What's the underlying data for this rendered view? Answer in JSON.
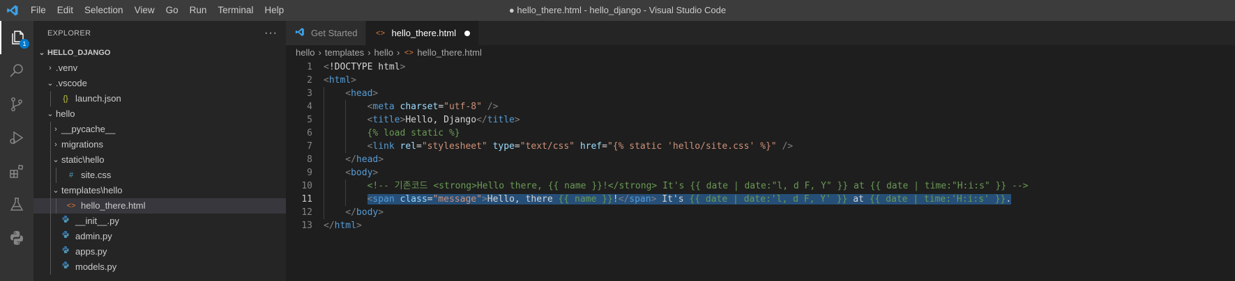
{
  "window": {
    "title": "● hello_there.html - hello_django - Visual Studio Code"
  },
  "menu": [
    "File",
    "Edit",
    "Selection",
    "View",
    "Go",
    "Run",
    "Terminal",
    "Help"
  ],
  "activity": {
    "items": [
      "explorer-icon",
      "search-icon",
      "source-control-icon",
      "run-debug-icon",
      "extensions-icon",
      "testing-icon",
      "python-icon"
    ],
    "explorer_badge": "1"
  },
  "sidebar": {
    "title": "EXPLORER",
    "more": "···",
    "root": "HELLO_DJANGO",
    "rows": [
      {
        "label": ".venv",
        "chev": "›",
        "icon": ""
      },
      {
        "label": ".vscode",
        "chev": "⌄",
        "icon": ""
      },
      {
        "label": "launch.json",
        "chev": "",
        "icon": "{}"
      },
      {
        "label": "hello",
        "chev": "⌄",
        "icon": ""
      },
      {
        "label": "__pycache__",
        "chev": "›",
        "icon": ""
      },
      {
        "label": "migrations",
        "chev": "›",
        "icon": ""
      },
      {
        "label": "static\\hello",
        "chev": "⌄",
        "icon": ""
      },
      {
        "label": "site.css",
        "chev": "",
        "icon": "#"
      },
      {
        "label": "templates\\hello",
        "chev": "⌄",
        "icon": ""
      },
      {
        "label": "hello_there.html",
        "chev": "",
        "icon": "<>"
      },
      {
        "label": "__init__.py",
        "chev": "",
        "icon": "py"
      },
      {
        "label": "admin.py",
        "chev": "",
        "icon": "py"
      },
      {
        "label": "apps.py",
        "chev": "",
        "icon": "py"
      },
      {
        "label": "models.py",
        "chev": "",
        "icon": "py"
      }
    ]
  },
  "tabs": [
    {
      "label": "Get Started",
      "icon": "vscode-logo-icon"
    },
    {
      "label": "hello_there.html",
      "icon": "html-file-icon",
      "dirty": "●"
    }
  ],
  "breadcrumbs": [
    "hello",
    "templates",
    "hello",
    "hello_there.html"
  ],
  "editor": {
    "current_line": 11,
    "lines": [
      {
        "n": "1",
        "indent": 0,
        "parts": [
          [
            "t-br",
            "<"
          ],
          [
            "t-txt",
            "!DOCTYPE html"
          ],
          [
            "t-br",
            ">"
          ]
        ]
      },
      {
        "n": "2",
        "indent": 0,
        "parts": [
          [
            "t-br",
            "<"
          ],
          [
            "t-tag",
            "html"
          ],
          [
            "t-br",
            ">"
          ]
        ]
      },
      {
        "n": "3",
        "indent": 1,
        "parts": [
          [
            "t-br",
            "<"
          ],
          [
            "t-tag",
            "head"
          ],
          [
            "t-br",
            ">"
          ]
        ]
      },
      {
        "n": "4",
        "indent": 2,
        "parts": [
          [
            "t-br",
            "<"
          ],
          [
            "t-tag",
            "meta"
          ],
          [
            "t-txt",
            " "
          ],
          [
            "t-attr",
            "charset"
          ],
          [
            "t-txt",
            "="
          ],
          [
            "t-str",
            "\"utf-8\""
          ],
          [
            "t-txt",
            " "
          ],
          [
            "t-br",
            "/>"
          ]
        ]
      },
      {
        "n": "5",
        "indent": 2,
        "parts": [
          [
            "t-br",
            "<"
          ],
          [
            "t-tag",
            "title"
          ],
          [
            "t-br",
            ">"
          ],
          [
            "t-txt",
            "Hello, Django"
          ],
          [
            "t-br",
            "</"
          ],
          [
            "t-tag",
            "title"
          ],
          [
            "t-br",
            ">"
          ]
        ]
      },
      {
        "n": "6",
        "indent": 2,
        "parts": [
          [
            "t-tpl",
            "{% load static %}"
          ]
        ]
      },
      {
        "n": "7",
        "indent": 2,
        "parts": [
          [
            "t-br",
            "<"
          ],
          [
            "t-tag",
            "link"
          ],
          [
            "t-txt",
            " "
          ],
          [
            "t-attr",
            "rel"
          ],
          [
            "t-txt",
            "="
          ],
          [
            "t-str",
            "\"stylesheet\""
          ],
          [
            "t-txt",
            " "
          ],
          [
            "t-attr",
            "type"
          ],
          [
            "t-txt",
            "="
          ],
          [
            "t-str",
            "\"text/css\""
          ],
          [
            "t-txt",
            " "
          ],
          [
            "t-attr",
            "href"
          ],
          [
            "t-txt",
            "="
          ],
          [
            "t-str",
            "\"{% static 'hello/site.css' %}\""
          ],
          [
            "t-txt",
            " "
          ],
          [
            "t-br",
            "/>"
          ]
        ]
      },
      {
        "n": "8",
        "indent": 1,
        "parts": [
          [
            "t-br",
            "</"
          ],
          [
            "t-tag",
            "head"
          ],
          [
            "t-br",
            ">"
          ]
        ]
      },
      {
        "n": "9",
        "indent": 1,
        "parts": [
          [
            "t-br",
            "<"
          ],
          [
            "t-tag",
            "body"
          ],
          [
            "t-br",
            ">"
          ]
        ]
      },
      {
        "n": "10",
        "indent": 2,
        "parts": [
          [
            "t-cmt",
            "<!-- 기존코드 <strong>Hello there, {{ name }}!</strong> It's {{ date | date:\"l, d F, Y\" }} at {{ date | time:\"H:i:s\" }} -->"
          ]
        ]
      },
      {
        "n": "11",
        "indent": 2,
        "sel": true,
        "parts": [
          [
            "t-br",
            "<"
          ],
          [
            "t-tag",
            "span"
          ],
          [
            "t-txt",
            " "
          ],
          [
            "t-attr",
            "class"
          ],
          [
            "t-txt",
            "="
          ],
          [
            "t-str",
            "\"message\""
          ],
          [
            "t-br",
            ">"
          ],
          [
            "t-txt",
            "Hello, there "
          ],
          [
            "t-tpl",
            "{{ name }}"
          ],
          [
            "t-txt",
            "!"
          ],
          [
            "t-br",
            "</"
          ],
          [
            "t-tag",
            "span"
          ],
          [
            "t-br",
            ">"
          ],
          [
            "t-txt",
            " It's "
          ],
          [
            "t-tpl",
            "{{ date | date:'l, d F, Y' }}"
          ],
          [
            "t-txt",
            " at "
          ],
          [
            "t-tpl",
            "{{ date | time:'H:i:s' }}"
          ],
          [
            "t-txt",
            "."
          ]
        ]
      },
      {
        "n": "12",
        "indent": 1,
        "parts": [
          [
            "t-br",
            "</"
          ],
          [
            "t-tag",
            "body"
          ],
          [
            "t-br",
            ">"
          ]
        ]
      },
      {
        "n": "13",
        "indent": 0,
        "parts": [
          [
            "t-br",
            "</"
          ],
          [
            "t-tag",
            "html"
          ],
          [
            "t-br",
            ">"
          ]
        ]
      }
    ]
  }
}
